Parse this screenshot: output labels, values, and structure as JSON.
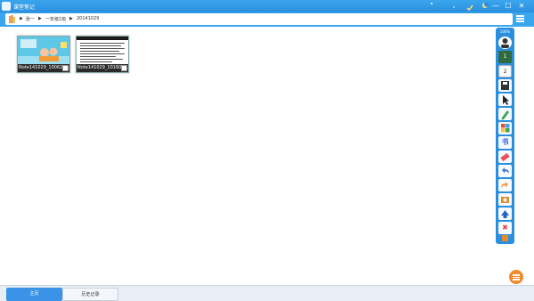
{
  "window": {
    "title": "课堂笔记",
    "minimize_glyph": "—",
    "maximize_glyph": "☐",
    "close_glyph": "✕"
  },
  "breadcrumb": {
    "items": [
      "张一",
      "一年级1班",
      "20141029"
    ]
  },
  "notes": [
    {
      "caption": "Note141029_100626...",
      "thumbnail": "classroom-cartoon"
    },
    {
      "caption": "Note141029_101601...",
      "thumbnail": "text-document"
    }
  ],
  "toolbar": {
    "label": "100%",
    "page_1": "1",
    "page_2": "2",
    "icons": [
      "avatar-icon",
      "page-1-icon",
      "page-2-icon",
      "save-icon",
      "pointer-icon",
      "pen-icon",
      "color-palette-icon",
      "book-icon",
      "eraser-icon",
      "undo-icon",
      "redo-icon",
      "screenshot-icon",
      "export-icon",
      "close-icon",
      "box-icon"
    ]
  },
  "bottom_tabs": {
    "home": "主页",
    "history": "历史记录"
  },
  "colors": {
    "accent": "#2b8fe0",
    "fab": "#f08a2c"
  }
}
